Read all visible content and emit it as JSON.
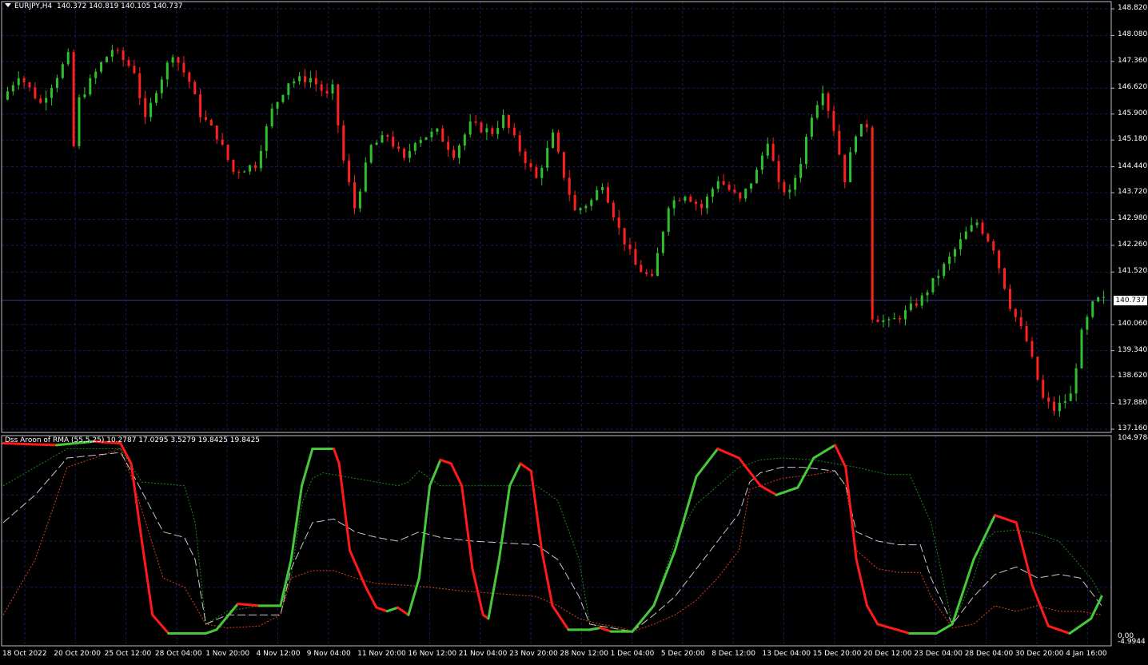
{
  "main": {
    "symbol": "EURJPY,H4",
    "ohlc": "140.372 140.819 140.105 140.737",
    "price_ticks": [
      "148.820",
      "148.080",
      "147.360",
      "146.620",
      "145.900",
      "145.180",
      "144.440",
      "143.720",
      "142.980",
      "142.260",
      "141.520",
      "140.060",
      "139.340",
      "138.620",
      "137.880",
      "137.160"
    ],
    "current_price": "140.737"
  },
  "indicator": {
    "title": "Dss Aroon of RMA (55,5,25) 10.2787 17.0295 3.5279 19.8425 19.8425",
    "scale_top": "104.9784",
    "scale_zero": "0.00",
    "scale_bottom": "-4.9944"
  },
  "time_axis": [
    "18 Oct 2022",
    "20 Oct 20:00",
    "25 Oct 12:00",
    "28 Oct 04:00",
    "1 Nov 20:00",
    "4 Nov 12:00",
    "9 Nov 04:00",
    "11 Nov 20:00",
    "16 Nov 12:00",
    "21 Nov 04:00",
    "23 Nov 20:00",
    "28 Nov 12:00",
    "1 Dec 04:00",
    "5 Dec 20:00",
    "8 Dec 12:00",
    "13 Dec 04:00",
    "15 Dec 20:00",
    "20 Dec 12:00",
    "23 Dec 04:00",
    "28 Dec 04:00",
    "30 Dec 20:00",
    "4 Jan 16:00"
  ],
  "colors": {
    "background": "#000000",
    "grid": "#1b1b5c",
    "bull_candle": "#2fc02f",
    "bear_candle": "#ff2020",
    "signal_up": "#47c83a",
    "signal_down": "#ff1a1a",
    "band_upper": "#1a8a1a",
    "band_lower": "#e0401a",
    "middle_line": "#c8c8c8"
  },
  "chart_data": [
    {
      "type": "candlestick",
      "title": "EURJPY,H4",
      "ylim": [
        137.16,
        148.82
      ],
      "price_path": [
        [
          0,
          146.3
        ],
        [
          3,
          147.0
        ],
        [
          7,
          146.2
        ],
        [
          12,
          147.5
        ],
        [
          13,
          145.0
        ],
        [
          14,
          146.3
        ],
        [
          18,
          147.3
        ],
        [
          20,
          147.7
        ],
        [
          24,
          147.1
        ],
        [
          26,
          145.7
        ],
        [
          28,
          146.6
        ],
        [
          31,
          147.6
        ],
        [
          34,
          146.8
        ],
        [
          36,
          145.9
        ],
        [
          39,
          145.3
        ],
        [
          42,
          144.3
        ],
        [
          46,
          144.5
        ],
        [
          49,
          146.0
        ],
        [
          52,
          146.8
        ],
        [
          56,
          146.9
        ],
        [
          59,
          146.4
        ],
        [
          60,
          146.6
        ],
        [
          62,
          144.6
        ],
        [
          64,
          143.3
        ],
        [
          67,
          145.0
        ],
        [
          70,
          145.3
        ],
        [
          73,
          144.6
        ],
        [
          75,
          145.2
        ],
        [
          79,
          145.4
        ],
        [
          82,
          144.8
        ],
        [
          85,
          145.6
        ],
        [
          89,
          145.4
        ],
        [
          91,
          145.8
        ],
        [
          94,
          144.9
        ],
        [
          97,
          144.1
        ],
        [
          100,
          145.3
        ],
        [
          102,
          144.2
        ],
        [
          104,
          143.2
        ],
        [
          107,
          143.5
        ],
        [
          109,
          144.0
        ],
        [
          112,
          142.7
        ],
        [
          115,
          141.7
        ],
        [
          118,
          141.3
        ],
        [
          121,
          143.4
        ],
        [
          124,
          143.7
        ],
        [
          127,
          143.3
        ],
        [
          130,
          144.1
        ],
        [
          134,
          143.5
        ],
        [
          137,
          144.3
        ],
        [
          139,
          145.2
        ],
        [
          141,
          143.9
        ],
        [
          143,
          143.7
        ],
        [
          145,
          144.6
        ],
        [
          147,
          145.9
        ],
        [
          149,
          146.6
        ],
        [
          151,
          145.5
        ],
        [
          153,
          144.1
        ],
        [
          155,
          145.4
        ],
        [
          157,
          145.6
        ],
        [
          158,
          140.3
        ],
        [
          161,
          140.1
        ],
        [
          164,
          140.4
        ],
        [
          167,
          140.8
        ],
        [
          172,
          141.9
        ],
        [
          175,
          142.6
        ],
        [
          177,
          142.9
        ],
        [
          180,
          142.2
        ],
        [
          183,
          140.6
        ],
        [
          186,
          139.6
        ],
        [
          189,
          138.0
        ],
        [
          191,
          137.7
        ],
        [
          194,
          138.1
        ],
        [
          196,
          139.8
        ],
        [
          198,
          140.6
        ],
        [
          199,
          140.74
        ]
      ]
    },
    {
      "type": "line",
      "title": "Dss Aroon of RMA (55,5,25)",
      "ylim": [
        -4.9944,
        104.9784
      ],
      "series": [
        {
          "values": [
            [
              0,
              103
            ],
            [
              10,
              102
            ],
            [
              17,
              104
            ],
            [
              22,
              103
            ],
            [
              24,
              92
            ],
            [
              26,
              50
            ],
            [
              28,
              10
            ],
            [
              31,
              0
            ],
            [
              38,
              0
            ],
            [
              40,
              2
            ],
            [
              44,
              16
            ],
            [
              48,
              15
            ],
            [
              52,
              15
            ],
            [
              54,
              40
            ],
            [
              56,
              80
            ],
            [
              58,
              100
            ],
            [
              62,
              100
            ],
            [
              63,
              92
            ],
            [
              65,
              45
            ],
            [
              68,
              25
            ],
            [
              70,
              14
            ],
            [
              72,
              12
            ],
            [
              74,
              14
            ],
            [
              76,
              10
            ],
            [
              78,
              30
            ],
            [
              80,
              80
            ],
            [
              82,
              94
            ],
            [
              84,
              92
            ],
            [
              86,
              80
            ],
            [
              88,
              35
            ],
            [
              90,
              10
            ],
            [
              91,
              8
            ],
            [
              93,
              40
            ],
            [
              95,
              80
            ],
            [
              97,
              92
            ],
            [
              99,
              88
            ],
            [
              101,
              45
            ],
            [
              103,
              15
            ],
            [
              106,
              2
            ],
            [
              110,
              2
            ],
            [
              112,
              3
            ],
            [
              114,
              1
            ],
            [
              118,
              1
            ],
            [
              122,
              15
            ],
            [
              126,
              45
            ],
            [
              130,
              85
            ],
            [
              134,
              100
            ],
            [
              138,
              95
            ],
            [
              142,
              80
            ],
            [
              145,
              75
            ],
            [
              149,
              79
            ],
            [
              152,
              95
            ],
            [
              156,
              102
            ],
            [
              158,
              90
            ],
            [
              160,
              40
            ],
            [
              162,
              15
            ],
            [
              164,
              5
            ],
            [
              170,
              0
            ],
            [
              175,
              0
            ],
            [
              178,
              5
            ],
            [
              182,
              40
            ],
            [
              186,
              64
            ],
            [
              190,
              60
            ],
            [
              193,
              26
            ],
            [
              196,
              4
            ],
            [
              200,
              0
            ],
            [
              204,
              8
            ],
            [
              206,
              20
            ]
          ]
        },
        {
          "values": [
            [
              0,
              80
            ],
            [
              6,
              90
            ],
            [
              12,
              100
            ],
            [
              22,
              100
            ],
            [
              26,
              82
            ],
            [
              34,
              80
            ],
            [
              36,
              60
            ],
            [
              38,
              5
            ],
            [
              42,
              12
            ],
            [
              48,
              15
            ],
            [
              52,
              15
            ],
            [
              54,
              30
            ],
            [
              56,
              70
            ],
            [
              58,
              84
            ],
            [
              60,
              87
            ],
            [
              62,
              86
            ],
            [
              66,
              84
            ],
            [
              70,
              82
            ],
            [
              74,
              80
            ],
            [
              76,
              82
            ],
            [
              78,
              88
            ],
            [
              82,
              80
            ],
            [
              100,
              80
            ],
            [
              104,
              72
            ],
            [
              108,
              40
            ],
            [
              110,
              5
            ],
            [
              114,
              3
            ],
            [
              118,
              1
            ],
            [
              122,
              15
            ],
            [
              126,
              50
            ],
            [
              130,
              70
            ],
            [
              134,
              80
            ],
            [
              138,
              90
            ],
            [
              142,
              94
            ],
            [
              146,
              95
            ],
            [
              152,
              94
            ],
            [
              156,
              92
            ],
            [
              160,
              90
            ],
            [
              166,
              86
            ],
            [
              170,
              86
            ],
            [
              174,
              60
            ],
            [
              178,
              5
            ],
            [
              182,
              30
            ],
            [
              184,
              50
            ],
            [
              186,
              55
            ],
            [
              190,
              56
            ],
            [
              194,
              54
            ],
            [
              198,
              50
            ],
            [
              204,
              30
            ],
            [
              206,
              20
            ]
          ]
        },
        {
          "values": [
            [
              0,
              10
            ],
            [
              6,
              40
            ],
            [
              12,
              90
            ],
            [
              22,
              100
            ],
            [
              24,
              85
            ],
            [
              30,
              30
            ],
            [
              34,
              25
            ],
            [
              38,
              5
            ],
            [
              42,
              3
            ],
            [
              48,
              4
            ],
            [
              52,
              10
            ],
            [
              54,
              30
            ],
            [
              58,
              34
            ],
            [
              62,
              34
            ],
            [
              66,
              30
            ],
            [
              70,
              27
            ],
            [
              76,
              26
            ],
            [
              80,
              25
            ],
            [
              86,
              23
            ],
            [
              100,
              20
            ],
            [
              104,
              15
            ],
            [
              108,
              8
            ],
            [
              112,
              5
            ],
            [
              116,
              3
            ],
            [
              118,
              1
            ],
            [
              122,
              5
            ],
            [
              126,
              10
            ],
            [
              130,
              18
            ],
            [
              134,
              30
            ],
            [
              138,
              45
            ],
            [
              140,
              78
            ],
            [
              142,
              80
            ],
            [
              146,
              84
            ],
            [
              152,
              86
            ],
            [
              156,
              88
            ],
            [
              158,
              80
            ],
            [
              160,
              45
            ],
            [
              164,
              35
            ],
            [
              168,
              33
            ],
            [
              172,
              33
            ],
            [
              174,
              20
            ],
            [
              178,
              3
            ],
            [
              182,
              5
            ],
            [
              186,
              15
            ],
            [
              190,
              12
            ],
            [
              194,
              15
            ],
            [
              198,
              12
            ],
            [
              202,
              12
            ],
            [
              206,
              10
            ]
          ]
        },
        {
          "values": [
            [
              0,
              60
            ],
            [
              6,
              75
            ],
            [
              12,
              95
            ],
            [
              22,
              98
            ],
            [
              24,
              88
            ],
            [
              30,
              55
            ],
            [
              34,
              52
            ],
            [
              36,
              40
            ],
            [
              38,
              5
            ],
            [
              42,
              10
            ],
            [
              48,
              10
            ],
            [
              52,
              10
            ],
            [
              54,
              35
            ],
            [
              58,
              60
            ],
            [
              62,
              62
            ],
            [
              66,
              55
            ],
            [
              70,
              52
            ],
            [
              74,
              50
            ],
            [
              78,
              55
            ],
            [
              82,
              52
            ],
            [
              88,
              50
            ],
            [
              100,
              48
            ],
            [
              104,
              40
            ],
            [
              108,
              20
            ],
            [
              110,
              5
            ],
            [
              116,
              2
            ],
            [
              118,
              1
            ],
            [
              122,
              10
            ],
            [
              126,
              20
            ],
            [
              130,
              35
            ],
            [
              134,
              50
            ],
            [
              138,
              65
            ],
            [
              140,
              82
            ],
            [
              142,
              87
            ],
            [
              146,
              90
            ],
            [
              150,
              90
            ],
            [
              156,
              88
            ],
            [
              158,
              80
            ],
            [
              160,
              55
            ],
            [
              164,
              50
            ],
            [
              168,
              48
            ],
            [
              172,
              48
            ],
            [
              174,
              30
            ],
            [
              178,
              5
            ],
            [
              182,
              20
            ],
            [
              186,
              32
            ],
            [
              190,
              36
            ],
            [
              194,
              30
            ],
            [
              198,
              32
            ],
            [
              202,
              30
            ],
            [
              206,
              15
            ]
          ]
        }
      ]
    }
  ]
}
